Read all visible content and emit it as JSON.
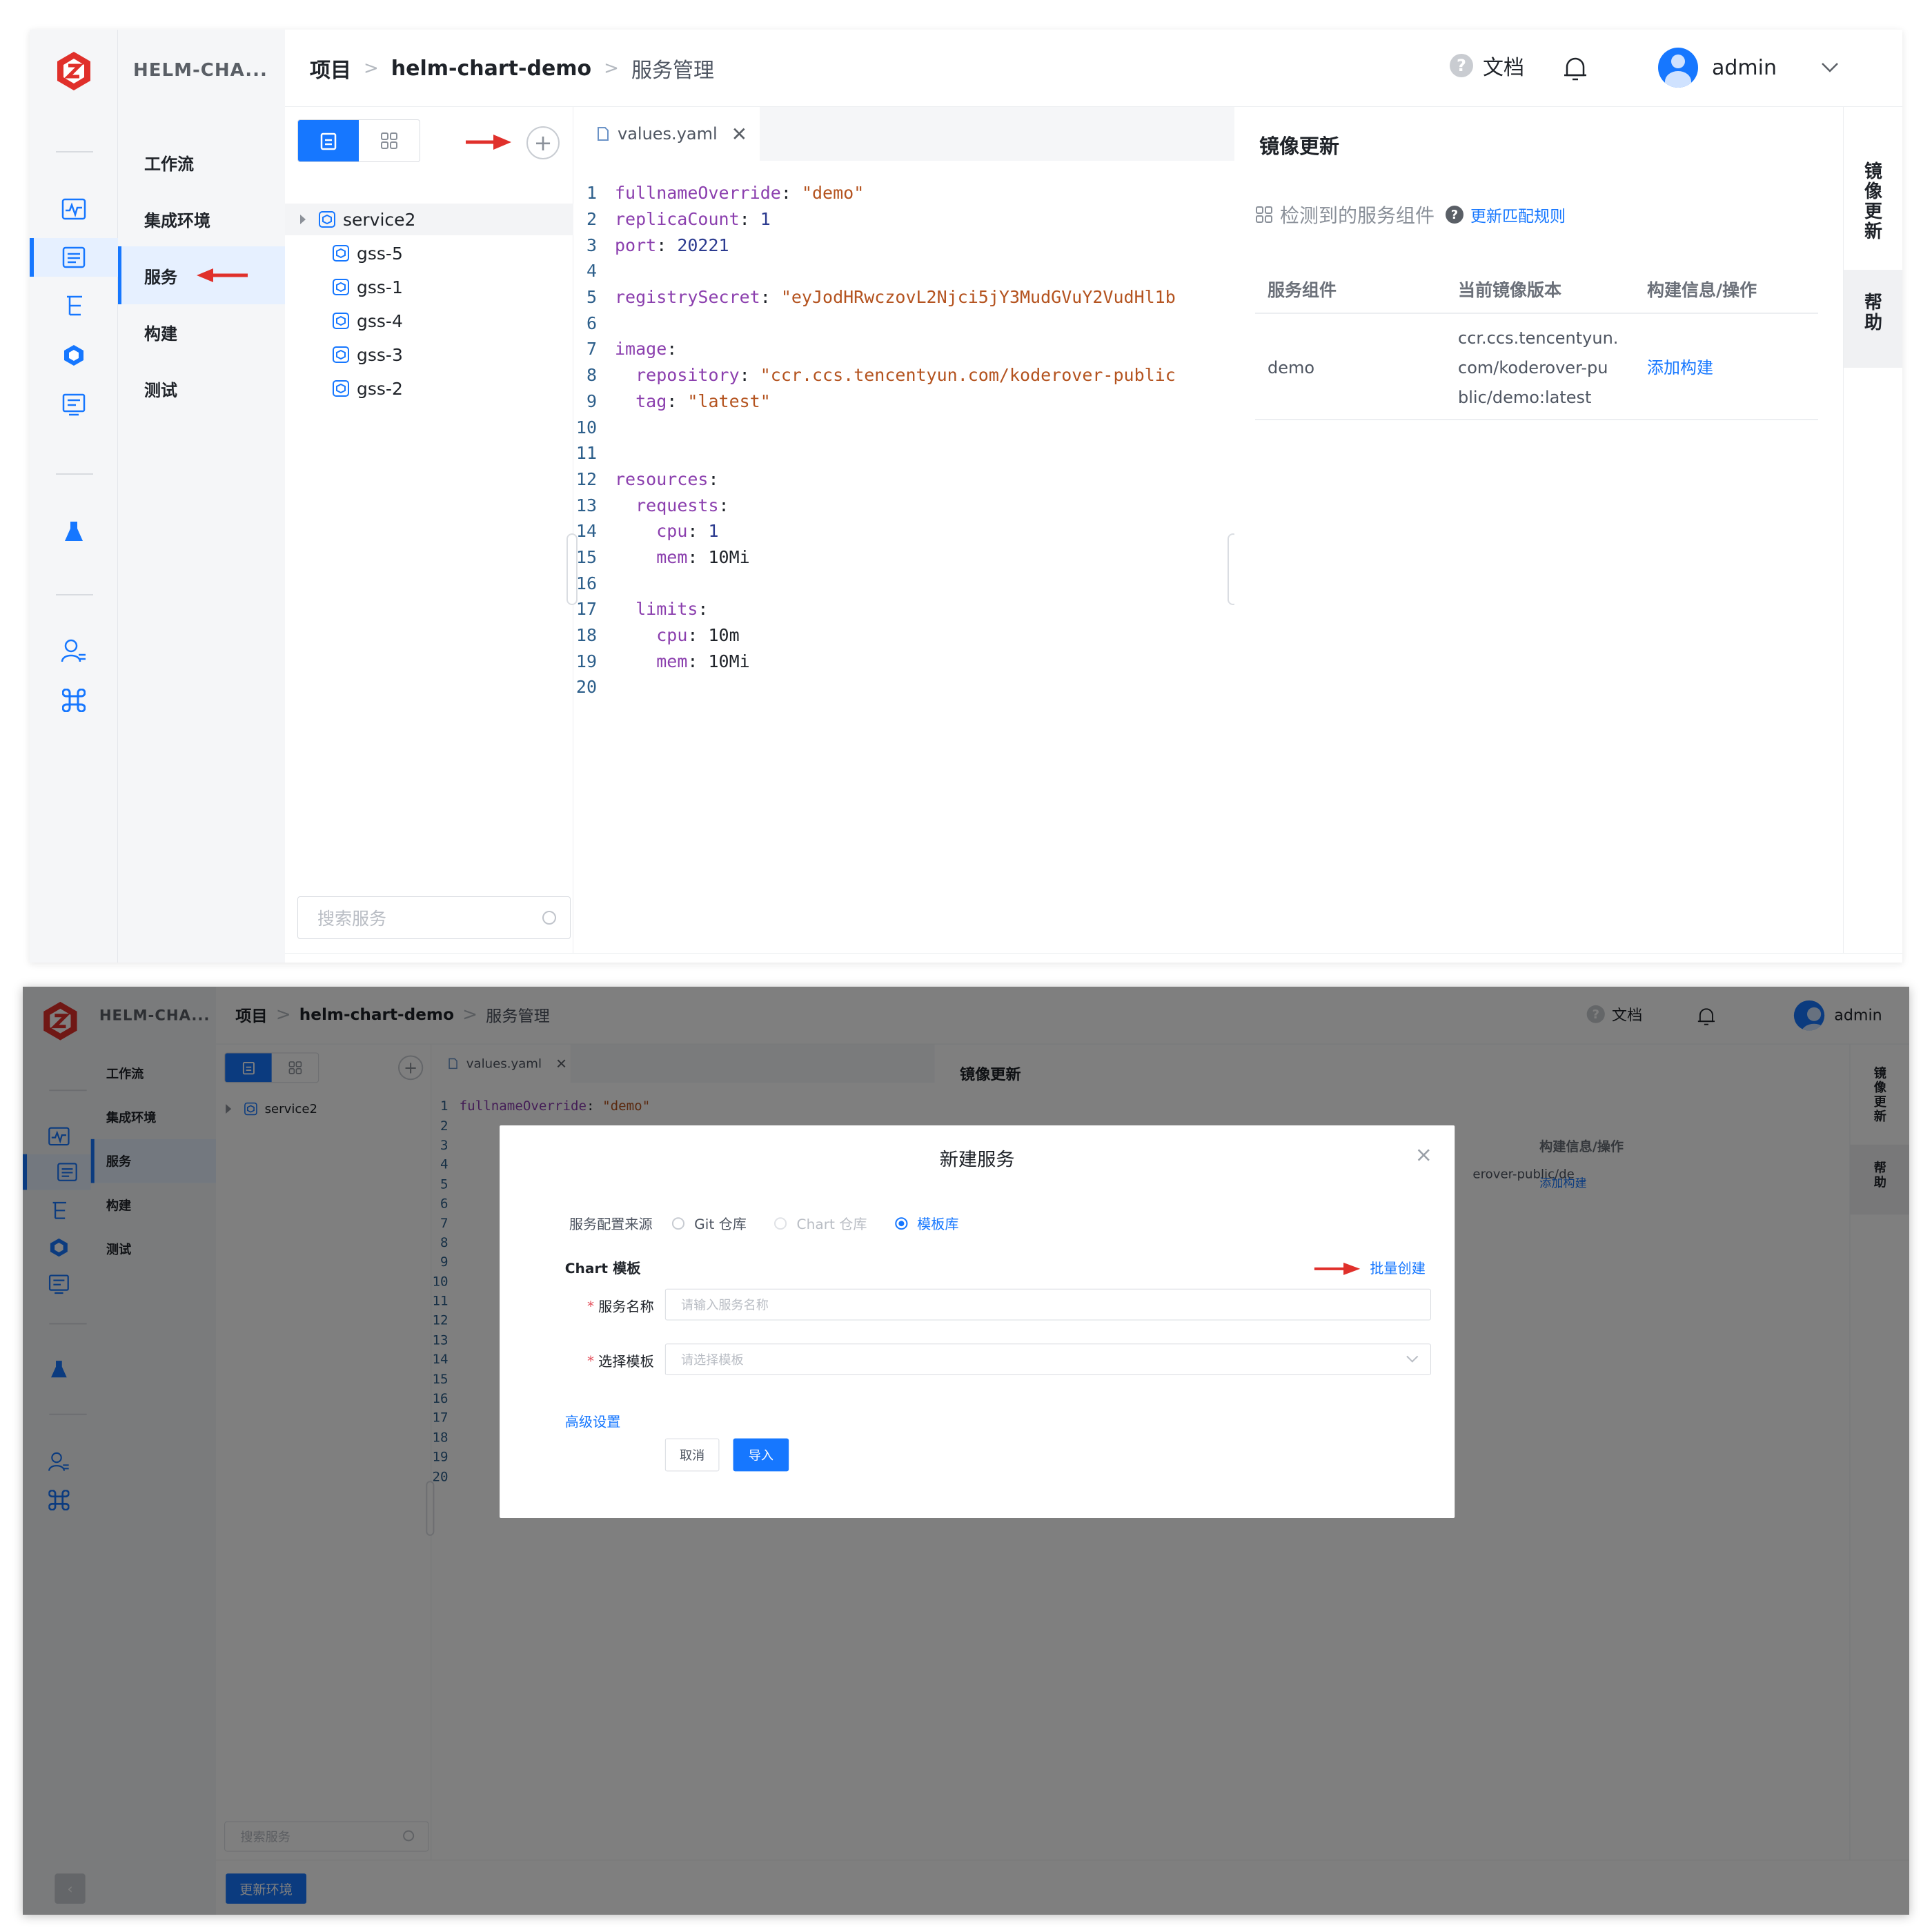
{
  "app": {
    "project_name": "HELM-CHA...",
    "nav": [
      "工作流",
      "集成环境",
      "服务",
      "构建",
      "测试"
    ],
    "breadcrumb": {
      "root": "项目",
      "project": "helm-chart-demo",
      "current": "服务管理",
      "sep": ">"
    },
    "topbar": {
      "docs_label": "文档",
      "user": "admin",
      "help_glyph": "?"
    },
    "rail_icons": [
      "logo-icon",
      "activity-icon",
      "services-icon",
      "tree-icon",
      "cube-icon",
      "monitor-icon",
      "flask-icon",
      "user-list-icon",
      "command-icon"
    ],
    "tree": {
      "items": [
        "service2",
        "gss-5",
        "gss-1",
        "gss-4",
        "gss-3",
        "gss-2"
      ],
      "search_placeholder": "搜索服务",
      "add_glyph": "+"
    },
    "editor": {
      "tab_label": "values.yaml",
      "close_glyph": "✕",
      "lines": [
        "1",
        "2",
        "3",
        "4",
        "5",
        "6",
        "7",
        "8",
        "9",
        "10",
        "11",
        "12",
        "13",
        "14",
        "15",
        "16",
        "17",
        "18",
        "19",
        "20"
      ],
      "code": {
        "l1k": "fullnameOverride",
        "l1v": "\"demo\"",
        "l2k": "replicaCount",
        "l2v": "1",
        "l3k": "port",
        "l3v": "20221",
        "l5k": "registrySecret",
        "l5v": "\"eyJodHRwczovL2Njci5jY3MudGVuY2VudHl1b",
        "l7k": "image",
        "l8k": "repository",
        "l8v": "\"ccr.ccs.tencentyun.com/koderover-public",
        "l9k": "tag",
        "l9v": "\"latest\"",
        "l12k": "resources",
        "l13k": "requests",
        "l14k": "cpu",
        "l14v": "1",
        "l15k": "mem",
        "l15v": "10Mi",
        "l17k": "limits",
        "l18k": "cpu",
        "l18v": "10m",
        "l19k": "mem",
        "l19v": "10Mi"
      }
    },
    "image_update": {
      "title": "镜像更新",
      "detected_label": "检测到的服务组件",
      "rule_link": "更新匹配规则",
      "columns": [
        "服务组件",
        "当前镜像版本",
        "构建信息/操作"
      ],
      "rows": [
        {
          "component": "demo",
          "image_lines": [
            "ccr.ccs.tencentyun.",
            "com/koderover-pu",
            "blic/demo:latest"
          ],
          "action": "添加构建"
        }
      ]
    },
    "vertical_tabs": [
      [
        "镜",
        "像",
        "更",
        "新"
      ],
      [
        "帮",
        "助"
      ]
    ]
  },
  "dialog": {
    "title": "新建服务",
    "close_glyph": "×",
    "source_label": "服务配置来源",
    "source_options": [
      {
        "label": "Git 仓库",
        "state": "enabled"
      },
      {
        "label": "Chart 仓库",
        "state": "disabled"
      },
      {
        "label": "模板库",
        "state": "selected"
      }
    ],
    "section_label": "Chart 模板",
    "batch_create": "批量创建",
    "fields": [
      {
        "label": "服务名称",
        "placeholder": "请输入服务名称"
      },
      {
        "label": "选择模板",
        "placeholder": "请选择模板"
      }
    ],
    "advanced": "高级设置",
    "cancel": "取消",
    "import": "导入",
    "required_mark": "*",
    "under_dialog": {
      "image_fragment": "erover-public/de",
      "update_env": "更新环境",
      "collapse_glyph": "‹"
    }
  },
  "colors": {
    "accent": "#1677ff",
    "arrow": "#e0302b",
    "overlay": "rgba(0,0,0,0.5)"
  }
}
